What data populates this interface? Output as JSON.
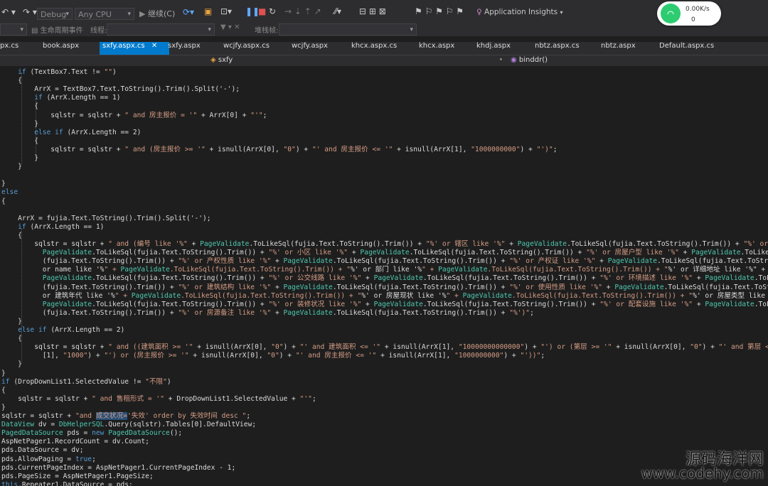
{
  "toolbar": {
    "config": "Debug",
    "platform": "Any CPU",
    "continue_label": "继续(C)",
    "app_insights": "Application Insights"
  },
  "toolbar2": {
    "lifecycle": "生命周期事件",
    "thread_label": "线程:",
    "stack_label": "堆栈帧:"
  },
  "tabs": [
    {
      "label": "px.cs",
      "active": false
    },
    {
      "label": "book.aspx",
      "active": false
    },
    {
      "label": "sxfy.aspx.cs",
      "active": true
    },
    {
      "label": "sxfy.aspx",
      "active": false
    },
    {
      "label": "wcjfy.aspx.cs",
      "active": false
    },
    {
      "label": "wcjfy.aspx",
      "active": false
    },
    {
      "label": "khcx.aspx.cs",
      "active": false
    },
    {
      "label": "khcx.aspx",
      "active": false
    },
    {
      "label": "khdj.aspx",
      "active": false
    },
    {
      "label": "nbtz.aspx.cs",
      "active": false
    },
    {
      "label": "nbtz.aspx",
      "active": false
    },
    {
      "label": "Default.aspx.cs",
      "active": false
    }
  ],
  "navbar": {
    "class_name": "sxfy",
    "method_name": "binddr()"
  },
  "network_widget": {
    "speed": "0.00K/s",
    "count": "0"
  },
  "watermark": {
    "line1": "源码海洋网",
    "line2": "www.codehy.com"
  },
  "code_lines": [
    "    if (TextBox7.Text != \"\")",
    "    {",
    "        ArrX = TextBox7.Text.ToString().Trim().Split('-');",
    "        if (ArrX.Length == 1)",
    "        {",
    "            sqlstr = sqlstr + \" and 房主报价 = '\" + ArrX[0] + \"'\";",
    "        }",
    "        else if (ArrX.Length == 2)",
    "        {",
    "            sqlstr = sqlstr + \" and (房主报价 >= '\" + isnull(ArrX[0], \"0\") + \"' and 房主报价 <= '\" + isnull(ArrX[1], \"1000000000\") + \"')\";",
    "        }",
    "    }",
    "",
    "}",
    "else",
    "{",
    "",
    "    ArrX = fujia.Text.ToString().Trim().Split('-');",
    "    if (ArrX.Length == 1)",
    "    {",
    "        sqlstr = sqlstr + \" and (编号 like '%\" + PageValidate.ToLikeSql(fujia.Text.ToString().Trim()) + \"%' or 辖区 like '%\" + PageValidate.ToLikeSql(fujia.Text.ToString().Trim()) + \"%' or 街道 like '%\" +",
    "          PageValidate.ToLikeSql(fujia.Text.ToString().Trim()) + \"%' or 小区 like '%\" + PageValidate.ToLikeSql(fujia.Text.ToString().Trim()) + \"%' or 房屋户型 like '%\" + PageValidate.ToLikeSql",
    "          (fujia.Text.ToString().Trim()) + \"%' or 产权性质 like '%\" + PageValidate.ToLikeSql(fujia.Text.ToString().Trim()) + \"%' or 产权证 like '%\" + PageValidate.ToLikeSql(fujia.Text.ToString().Trim()) +",
    "          or name like '%\" + PageValidate.ToLikeSql(fujia.Text.ToString().Trim()) + \"%' or 部门 like '%\" + PageValidate.ToLikeSql(fujia.Text.ToString().Trim()) + \"%' or 详细地址 like '%\" +",
    "          PageValidate.ToLikeSql(fujia.Text.ToString().Trim()) + \"%' or 公交线路 like '%\" + PageValidate.ToLikeSql(fujia.Text.ToString().Trim()) + \"%' or 环境描述 like '%\" + PageValidate.ToLikeSql",
    "          (fujia.Text.ToString().Trim()) + \"%' or 建筑结构 like '%\" + PageValidate.ToLikeSql(fujia.Text.ToString().Trim()) + \"%' or 使用性质 like '%\" + PageValidate.ToLikeSql(fujia.Text.ToString().Trim())",
    "          or 建筑年代 like '%\" + PageValidate.ToLikeSql(fujia.Text.ToString().Trim()) + \"%' or 房屋现状 like '%\" + PageValidate.ToLikeSql(fujia.Text.ToString().Trim()) + \"%' or 房屋类型 like '%\" +",
    "          PageValidate.ToLikeSql(fujia.Text.ToString().Trim()) + \"%' or 装修状况 like '%\" + PageValidate.ToLikeSql(fujia.Text.ToString().Trim()) + \"%' or 配套设施 like '%\" + PageValidate.ToLikeSql",
    "          (fujia.Text.ToString().Trim()) + \"%' or 房源备注 like '%\" + PageValidate.ToLikeSql(fujia.Text.ToString().Trim()) + \"%')\";",
    "    }",
    "    else if (ArrX.Length == 2)",
    "    {",
    "        sqlstr = sqlstr + \" and ((建筑面积 >= '\" + isnull(ArrX[0], \"0\") + \"' and 建筑面积 <= '\" + isnull(ArrX[1], \"10000000000000\") + \"') or (第层 >= '\" + isnull(ArrX[0], \"0\") + \"' and 第层 <= '\" + isnull",
    "          [1], \"1000\") + \"') or (房主报价 >= '\" + isnull(ArrX[0], \"0\") + \"' and 房主报价 <= '\" + isnull(ArrX[1], \"1000000000\") + \"'))\";",
    "    }",
    "}",
    "if (DropDownList1.SelectedValue != \"不限\")",
    "{",
    "    sqlstr = sqlstr + \" and 售租形式 = '\" + DropDownList1.SelectedValue + \"'\";",
    "}",
    "sqlstr = sqlstr + \"and 成交状况='失效' order by 失效时间 desc \";",
    "DataView dv = DbHelperSQL.Query(sqlstr).Tables[0].DefaultView;",
    "PagedDataSource pds = new PagedDataSource();",
    "AspNetPager1.RecordCount = dv.Count;",
    "pds.DataSource = dv;",
    "pds.AllowPaging = true;",
    "pds.CurrentPageIndex = AspNetPager1.CurrentPageIndex - 1;",
    "pds.PageSize = AspNetPager1.PageSize;",
    "this.Repeater1.DataSource = pds;"
  ]
}
